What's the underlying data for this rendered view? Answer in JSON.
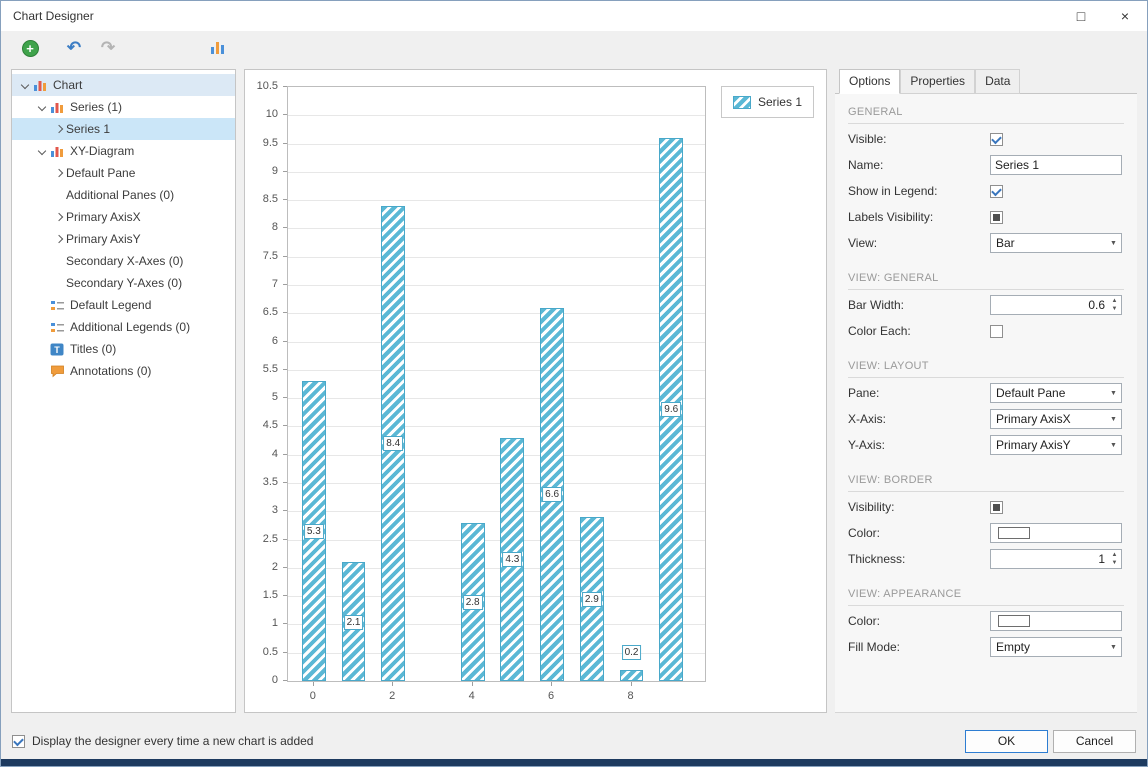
{
  "window": {
    "title": "Chart Designer",
    "maximize_glyph": "□",
    "close_glyph": "×"
  },
  "toolbar": {
    "add_glyph": "+",
    "undo_glyph": "↶",
    "redo_glyph": "↷"
  },
  "tree": {
    "items": [
      {
        "label": "Chart",
        "level": 0,
        "expander": "expanded",
        "icon": "chart",
        "highlight": "soft"
      },
      {
        "label": "Series (1)",
        "level": 1,
        "expander": "expanded",
        "icon": "chart"
      },
      {
        "label": "Series 1",
        "level": 2,
        "expander": "collapsed",
        "highlight": "selected"
      },
      {
        "label": "XY-Diagram",
        "level": 1,
        "expander": "expanded",
        "icon": "chart"
      },
      {
        "label": "Default Pane",
        "level": 2,
        "expander": "collapsed"
      },
      {
        "label": "Additional Panes (0)",
        "level": 2
      },
      {
        "label": "Primary AxisX",
        "level": 2,
        "expander": "collapsed"
      },
      {
        "label": "Primary AxisY",
        "level": 2,
        "expander": "collapsed"
      },
      {
        "label": "Secondary X-Axes (0)",
        "level": 2
      },
      {
        "label": "Secondary Y-Axes (0)",
        "level": 2
      },
      {
        "label": "Default Legend",
        "level": 1,
        "icon": "legend"
      },
      {
        "label": "Additional Legends (0)",
        "level": 1,
        "icon": "legend"
      },
      {
        "label": "Titles (0)",
        "level": 1,
        "icon": "title"
      },
      {
        "label": "Annotations (0)",
        "level": 1,
        "icon": "annotation"
      }
    ]
  },
  "chart_data": {
    "type": "bar",
    "series": [
      {
        "name": "Series 1",
        "x": [
          0,
          1,
          2,
          4,
          5,
          6,
          7,
          8,
          9
        ],
        "values": [
          5.3,
          2.1,
          8.4,
          2.8,
          4.3,
          6.6,
          2.9,
          0.2,
          9.6
        ]
      }
    ],
    "bar_width_ratio": 0.6,
    "xlim": [
      -0.65,
      9.85
    ],
    "ylim": [
      0,
      10.5
    ],
    "y_tick_step": 0.5,
    "x_ticks": [
      0,
      2,
      4,
      6,
      8
    ],
    "bar_color": "#5bb8d5",
    "bar_border_color": "#49a8c9",
    "hatch": "diagonal",
    "grid": "horizontal",
    "legend": [
      "Series 1"
    ],
    "legend_position": "top-right"
  },
  "panel": {
    "tabs": [
      {
        "label": "Options",
        "active": true
      },
      {
        "label": "Properties",
        "active": false
      },
      {
        "label": "Data",
        "active": false
      }
    ],
    "sections": [
      {
        "title": "GENERAL",
        "rows": [
          {
            "label": "Visible:",
            "control": "checkbox",
            "state": "checked"
          },
          {
            "label": "Name:",
            "control": "text",
            "value": "Series 1"
          },
          {
            "label": "Show in Legend:",
            "control": "checkbox",
            "state": "checked"
          },
          {
            "label": "Labels Visibility:",
            "control": "checkbox",
            "state": "indeterminate"
          },
          {
            "label": "View:",
            "control": "dropdown",
            "value": "Bar"
          }
        ]
      },
      {
        "title": "VIEW: GENERAL",
        "rows": [
          {
            "label": "Bar Width:",
            "control": "spinner",
            "value": "0.6"
          },
          {
            "label": "Color Each:",
            "control": "checkbox",
            "state": "unchecked"
          }
        ]
      },
      {
        "title": "VIEW: LAYOUT",
        "rows": [
          {
            "label": "Pane:",
            "control": "dropdown",
            "value": "Default Pane"
          },
          {
            "label": "X-Axis:",
            "control": "dropdown",
            "value": "Primary AxisX"
          },
          {
            "label": "Y-Axis:",
            "control": "dropdown",
            "value": "Primary AxisY"
          }
        ]
      },
      {
        "title": "VIEW: BORDER",
        "rows": [
          {
            "label": "Visibility:",
            "control": "checkbox",
            "state": "indeterminate"
          },
          {
            "label": "Color:",
            "control": "color",
            "value": "#ffffff"
          },
          {
            "label": "Thickness:",
            "control": "spinner",
            "value": "1"
          }
        ]
      },
      {
        "title": "VIEW: APPEARANCE",
        "rows": [
          {
            "label": "Color:",
            "control": "color",
            "value": "#ffffff"
          },
          {
            "label": "Fill Mode:",
            "control": "dropdown",
            "value": "Empty"
          }
        ]
      }
    ]
  },
  "footer": {
    "checkbox_label": "Display the designer every time a new chart is added",
    "checkbox_checked": true,
    "ok_label": "OK",
    "cancel_label": "Cancel"
  }
}
